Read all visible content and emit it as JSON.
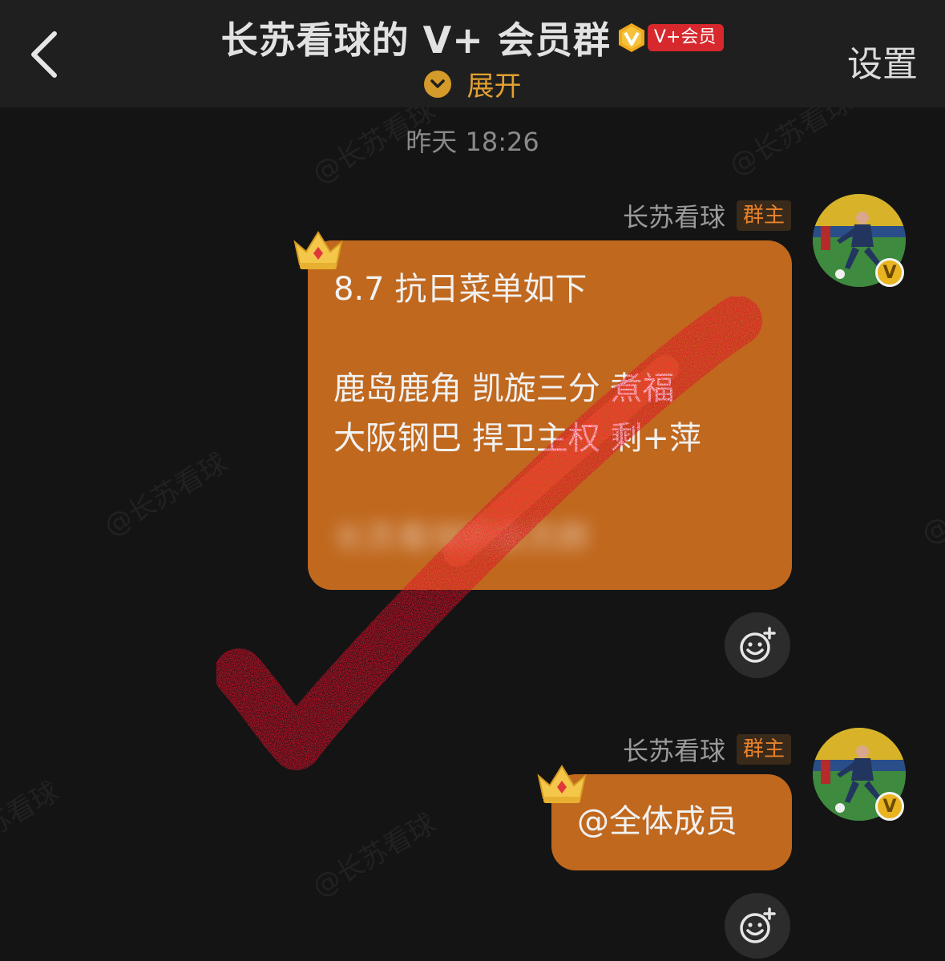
{
  "header": {
    "title": "长苏看球的 V+ 会员群",
    "vip_tag": "V+会员",
    "expand_label": "展开",
    "settings_label": "设置"
  },
  "watermark": "@长苏看球",
  "timestamp": "昨天 18:26",
  "messages": [
    {
      "sender": "长苏看球",
      "role": "群主",
      "lines": [
        "8.7 抗日菜单如下",
        "",
        "鹿岛鹿角 凯旋三分 煮福",
        "大阪钢巴 捍卫主权 剩+萍"
      ],
      "blurred_text": "长苏看球的会员群"
    },
    {
      "sender": "长苏看球",
      "role": "群主",
      "lines": [
        "@全体成员"
      ]
    }
  ],
  "colors": {
    "bubble": "#c0681e",
    "accent": "#e2a030",
    "role_badge_text": "#e8822a",
    "vip_tag": "#d6282d",
    "checkmark": "#e0102a"
  },
  "icons": {
    "back": "chevron-left-icon",
    "expand": "chevron-down-icon",
    "react": "add-emoji-icon",
    "crown": "crown-icon",
    "vip": "vip-badge-icon"
  }
}
